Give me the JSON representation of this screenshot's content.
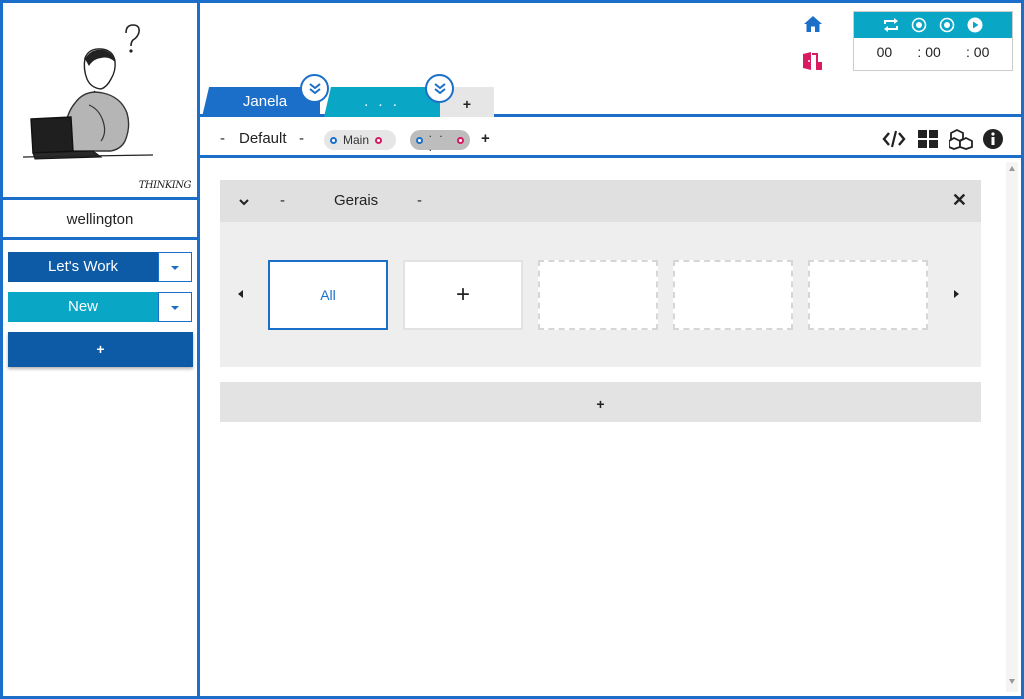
{
  "user": {
    "name": "wellington",
    "illustration_caption": "THINKING"
  },
  "sidebar": {
    "work_button": "Let's Work",
    "new_button": "New",
    "add_button": "+"
  },
  "header": {
    "icons": [
      "home-icon",
      "exit-door-icon"
    ],
    "timer": {
      "controls": [
        "repeat-icon",
        "record-icon",
        "record-icon",
        "play-icon"
      ],
      "hours": "00",
      "minutes": ": 00",
      "seconds": ": 00"
    },
    "tabs": [
      {
        "label": "Janela"
      },
      {
        "label": ". . ."
      }
    ],
    "add_tab": "+"
  },
  "subbar": {
    "minus_left": "-",
    "layout_name": "Default",
    "minus_right": "-",
    "pills": [
      {
        "label": "Main"
      },
      {
        "label": ". . ."
      }
    ],
    "add": "+",
    "tools": [
      "code-icon",
      "grid-icon",
      "cubes-icon",
      "info-icon"
    ]
  },
  "panel": {
    "minus_left": "-",
    "title": "Gerais",
    "minus_right": "-",
    "close": "✕",
    "cards": [
      {
        "label": "All"
      },
      {
        "label": "+"
      }
    ]
  },
  "add_section": "+",
  "colors": {
    "primary": "#1c6fc9",
    "dark_blue": "#0d5aa7",
    "cyan": "#0aa6c6",
    "exit_red": "#d81b60"
  }
}
